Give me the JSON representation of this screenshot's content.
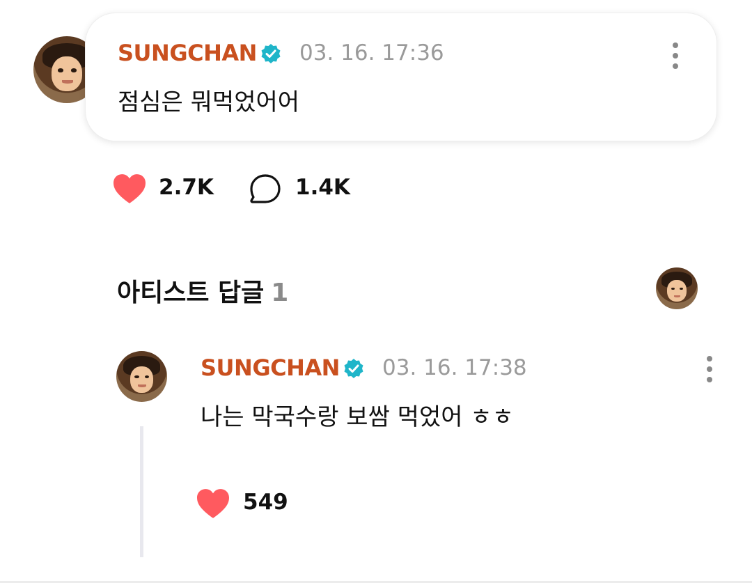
{
  "post": {
    "author": "SUNGCHAN",
    "timestamp": "03. 16. 17:36",
    "message": "점심은 뭐먹었어어",
    "likes": "2.7K",
    "comments": "1.4K"
  },
  "artist_replies": {
    "title": "아티스트 답글",
    "count": "1"
  },
  "reply": {
    "author": "SUNGCHAN",
    "timestamp": "03. 16. 17:38",
    "message": "나는 막국수랑 보쌈 먹었어 ㅎㅎ",
    "likes": "549"
  },
  "colors": {
    "author_name": "#c9501f",
    "verified_badge": "#1fb5c9",
    "heart": "#ff5a5f",
    "timestamp": "#9a9a9a"
  },
  "icons": [
    "verified-badge-icon",
    "heart-icon",
    "comment-bubble-icon",
    "more-options-icon"
  ]
}
